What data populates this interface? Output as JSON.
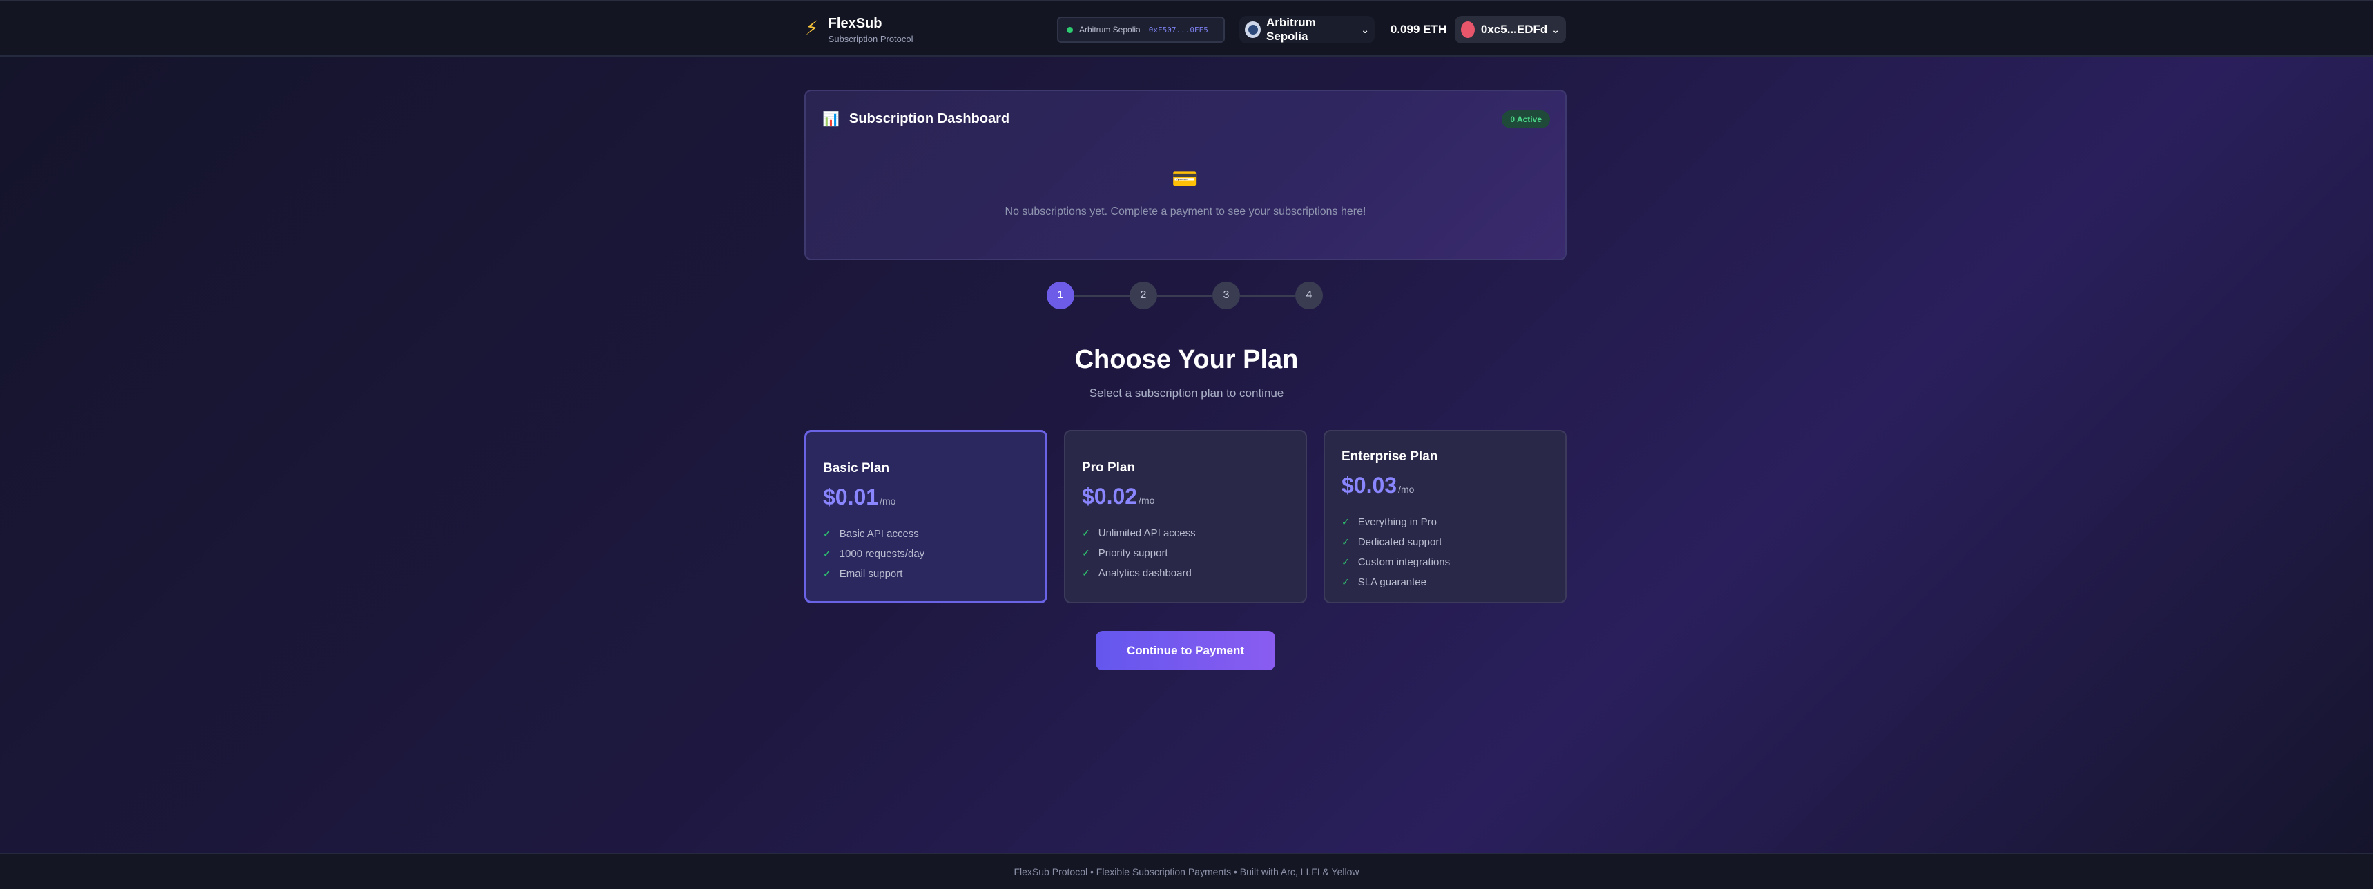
{
  "header": {
    "brand_icon": "bolt-icon",
    "brand_title": "FlexSub",
    "brand_subtitle": "Subscription Protocol",
    "network_status": {
      "label": "Arbitrum Sepolia",
      "address": "0xE507...0EE5",
      "status_color": "#2ecc71"
    },
    "chain_selector": {
      "label": "Arbitrum Sepolia",
      "chevron": "⌄"
    },
    "balance": "0.099 ETH",
    "account": {
      "label": "0xc5...EDFd",
      "chevron": "⌄",
      "avatar_color": "#e8566b"
    }
  },
  "dashboard": {
    "icon": "📊",
    "title": "Subscription Dashboard",
    "badge": "0 Active",
    "empty_icon": "💳",
    "empty_text": "No subscriptions yet. Complete a payment to see your subscriptions here!"
  },
  "stepper": {
    "steps": [
      "1",
      "2",
      "3",
      "4"
    ],
    "active_step": 1
  },
  "main": {
    "title": "Choose Your Plan",
    "subtitle": "Select a subscription plan to continue"
  },
  "plans": [
    {
      "name": "Basic Plan",
      "price": "$0.01",
      "period": "/mo",
      "selected": true,
      "features": [
        "Basic API access",
        "1000 requests/day",
        "Email support"
      ]
    },
    {
      "name": "Pro Plan",
      "price": "$0.02",
      "period": "/mo",
      "selected": false,
      "features": [
        "Unlimited API access",
        "Priority support",
        "Analytics dashboard"
      ]
    },
    {
      "name": "Enterprise Plan",
      "price": "$0.03",
      "period": "/mo",
      "selected": false,
      "features": [
        "Everything in Pro",
        "Dedicated support",
        "Custom integrations",
        "SLA guarantee"
      ]
    }
  ],
  "check_glyph": "✓",
  "cta_label": "Continue to Payment",
  "footer_text": "FlexSub Protocol • Flexible Subscription Payments • Built with Arc, LI.FI & Yellow",
  "colors": {
    "accent": "#6c5ce7",
    "price": "#8a86ff",
    "success": "#2ecc71"
  }
}
